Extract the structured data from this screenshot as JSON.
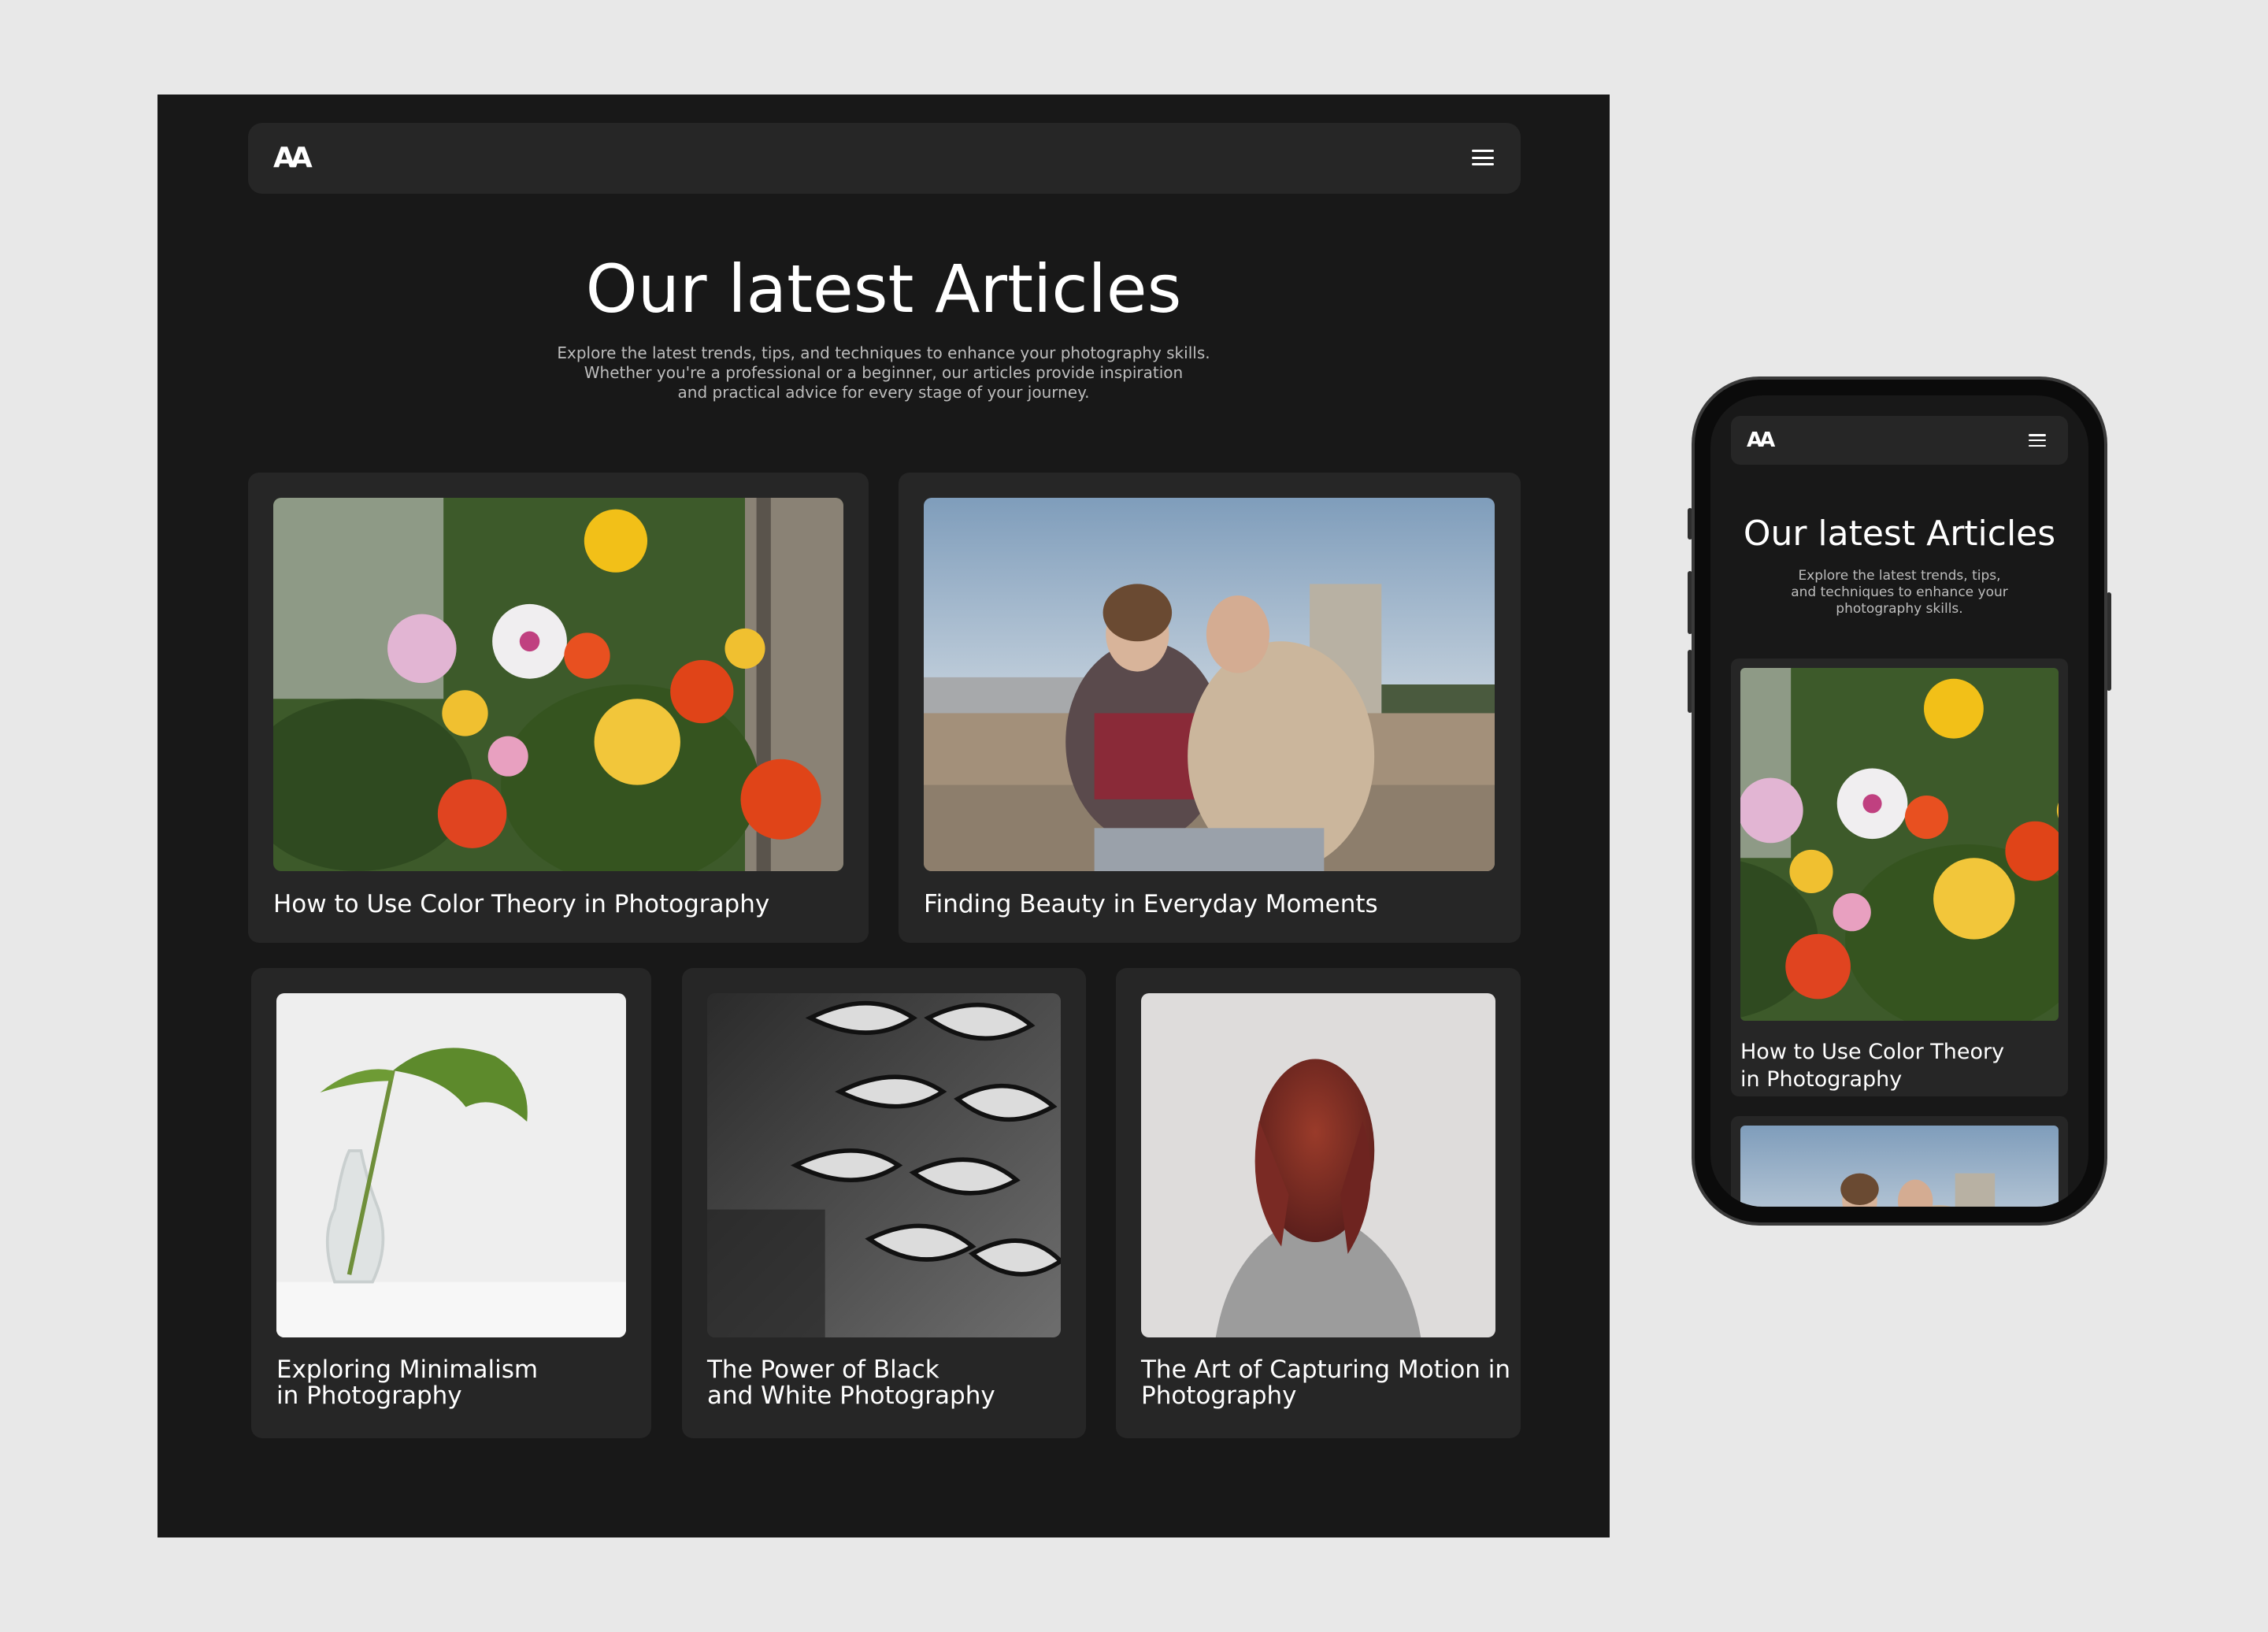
{
  "brand": {
    "logo": "AA"
  },
  "hero": {
    "title": "Our latest Articles",
    "subtitle_lines": [
      "Explore the latest trends, tips, and techniques to enhance your photography skills.",
      "Whether you're a professional or a beginner, our articles provide inspiration",
      "and practical advice for every stage of your journey."
    ]
  },
  "articles": [
    {
      "title_lines": [
        "How to Use Color Theory in Photography"
      ],
      "image": "flowers"
    },
    {
      "title_lines": [
        "Finding Beauty in Everyday Moments"
      ],
      "image": "two-women-seaside"
    },
    {
      "title_lines": [
        "Exploring Minimalism",
        "in Photography"
      ],
      "image": "monstera-vase"
    },
    {
      "title_lines": [
        "The Power of Black",
        "and White Photography"
      ],
      "image": "pinecone-bw"
    },
    {
      "title_lines": [
        "The Art of Capturing Motion in",
        "Photography"
      ],
      "image": "hair-motion"
    }
  ],
  "mobile": {
    "hero": {
      "title": "Our latest Articles",
      "subtitle_lines": [
        "Explore the latest trends, tips,",
        "and techniques to enhance your",
        "photography skills."
      ]
    },
    "articles": [
      {
        "title_lines": [
          "How to Use Color Theory",
          "in Photography"
        ],
        "image": "flowers"
      },
      {
        "title_lines": [],
        "image": "two-women-seaside"
      }
    ]
  },
  "icons": {
    "menu": "hamburger-menu-icon"
  },
  "colors": {
    "page_bg": "#e8e8e8",
    "app_bg": "#181818",
    "card_bg": "#262626",
    "text": "#ffffff",
    "muted": "#bdbdbd"
  }
}
